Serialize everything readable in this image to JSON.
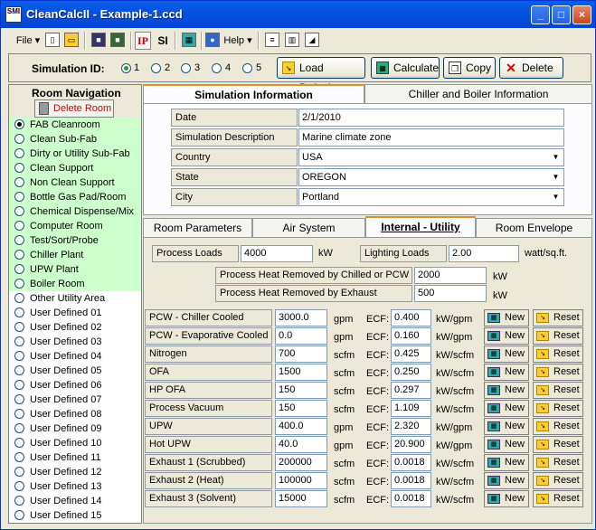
{
  "window": {
    "title": "CleanCalcII - Example-1.ccd",
    "app_icon": "SMI",
    "min": "_",
    "max": "□",
    "close": "×"
  },
  "toolbar": {
    "file": "File ▾",
    "ip": "IP",
    "si": "SI",
    "help": "Help ▾"
  },
  "simbar": {
    "label": "Simulation ID:",
    "ids": [
      "1",
      "2",
      "3",
      "4",
      "5"
    ],
    "selected": "1",
    "load_defaults": "Load Defaults",
    "calculate": "Calculate",
    "copy": "Copy",
    "delete": "Delete"
  },
  "nav": {
    "title": "Room Navigation",
    "delete_room": "Delete Room",
    "items": [
      {
        "label": "FAB Cleanroom",
        "green": true,
        "selected": true
      },
      {
        "label": "Clean Sub-Fab",
        "green": true
      },
      {
        "label": "Dirty or Utility Sub-Fab",
        "green": true
      },
      {
        "label": "Clean Support",
        "green": true
      },
      {
        "label": "Non Clean Support",
        "green": true
      },
      {
        "label": "Bottle Gas Pad/Room",
        "green": true
      },
      {
        "label": "Chemical Dispense/Mix",
        "green": true
      },
      {
        "label": "Computer Room",
        "green": true
      },
      {
        "label": "Test/Sort/Probe",
        "green": true
      },
      {
        "label": "Chiller Plant",
        "green": true
      },
      {
        "label": "UPW Plant",
        "green": true
      },
      {
        "label": "Boiler Room",
        "green": true
      },
      {
        "label": "Other Utility Area",
        "green": false
      },
      {
        "label": "User Defined 01",
        "green": false
      },
      {
        "label": "User Defined 02",
        "green": false
      },
      {
        "label": "User Defined 03",
        "green": false
      },
      {
        "label": "User Defined 04",
        "green": false
      },
      {
        "label": "User Defined 05",
        "green": false
      },
      {
        "label": "User Defined 06",
        "green": false
      },
      {
        "label": "User Defined 07",
        "green": false
      },
      {
        "label": "User Defined 08",
        "green": false
      },
      {
        "label": "User Defined 09",
        "green": false
      },
      {
        "label": "User Defined 10",
        "green": false
      },
      {
        "label": "User Defined 11",
        "green": false
      },
      {
        "label": "User Defined 12",
        "green": false
      },
      {
        "label": "User Defined 13",
        "green": false
      },
      {
        "label": "User Defined 14",
        "green": false
      },
      {
        "label": "User Defined 15",
        "green": false
      }
    ]
  },
  "top_tabs": [
    "Simulation Information",
    "Chiller and Boiler Information"
  ],
  "sim_info": {
    "date_label": "Date",
    "date": "2/1/2010",
    "desc_label": "Simulation Description",
    "desc": "Marine climate zone",
    "country_label": "Country",
    "country": "USA",
    "state_label": "State",
    "state": "OREGON",
    "city_label": "City",
    "city": "Portland"
  },
  "mid_tabs": [
    "Room Parameters",
    "Air System",
    "Internal - Utility",
    "Room Envelope"
  ],
  "internal": {
    "process_loads_label": "Process Loads",
    "process_loads": "4000",
    "process_loads_unit": "kW",
    "lighting_loads_label": "Lighting Loads",
    "lighting_loads": "2.00",
    "lighting_loads_unit": "watt/sq.ft.",
    "pcw_heat_label": "Process Heat Removed by Chilled or PCW",
    "pcw_heat": "2000",
    "pcw_heat_unit": "kW",
    "exhaust_heat_label": "Process Heat Removed by Exhaust",
    "exhaust_heat": "500",
    "exhaust_heat_unit": "kW",
    "ecf_label": "ECF:",
    "new_label": "New",
    "reset_label": "Reset",
    "rows": [
      {
        "name": "PCW - Chiller Cooled",
        "value": "3000.0",
        "unit": "gpm",
        "ecf": "0.400",
        "ecf_unit": "kW/gpm"
      },
      {
        "name": "PCW - Evaporative Cooled",
        "value": "0.0",
        "unit": "gpm",
        "ecf": "0.160",
        "ecf_unit": "kW/gpm"
      },
      {
        "name": "Nitrogen",
        "value": "700",
        "unit": "scfm",
        "ecf": "0.425",
        "ecf_unit": "kW/scfm"
      },
      {
        "name": "OFA",
        "value": "1500",
        "unit": "scfm",
        "ecf": "0.250",
        "ecf_unit": "kW/scfm"
      },
      {
        "name": "HP OFA",
        "value": "150",
        "unit": "scfm",
        "ecf": "0.297",
        "ecf_unit": "kW/scfm"
      },
      {
        "name": "Process Vacuum",
        "value": "150",
        "unit": "scfm",
        "ecf": "1.109",
        "ecf_unit": "kW/scfm"
      },
      {
        "name": "UPW",
        "value": "400.0",
        "unit": "gpm",
        "ecf": "2.320",
        "ecf_unit": "kW/gpm"
      },
      {
        "name": "Hot UPW",
        "value": "40.0",
        "unit": "gpm",
        "ecf": "20.900",
        "ecf_unit": "kW/gpm"
      },
      {
        "name": "Exhaust 1 (Scrubbed)",
        "value": "200000",
        "unit": "scfm",
        "ecf": "0.0018",
        "ecf_unit": "kW/scfm"
      },
      {
        "name": "Exhaust 2 (Heat)",
        "value": "100000",
        "unit": "scfm",
        "ecf": "0.0018",
        "ecf_unit": "kW/scfm"
      },
      {
        "name": "Exhaust 3 (Solvent)",
        "value": "15000",
        "unit": "scfm",
        "ecf": "0.0018",
        "ecf_unit": "kW/scfm"
      }
    ]
  }
}
